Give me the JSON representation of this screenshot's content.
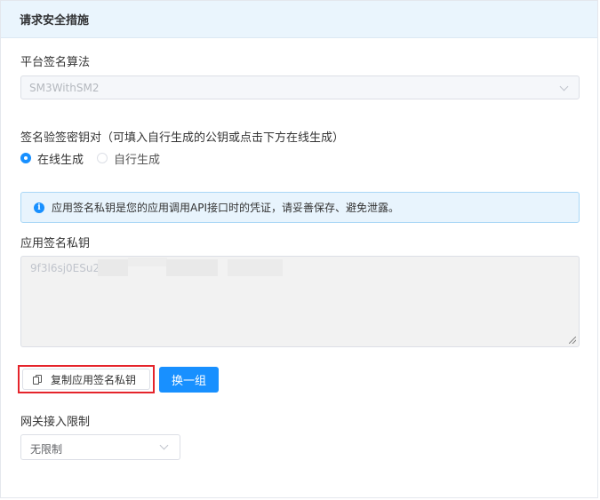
{
  "panel": {
    "title": "请求安全措施"
  },
  "algorithm": {
    "label": "平台签名算法",
    "value": "SM3WithSM2"
  },
  "keypair": {
    "label": "签名验签密钥对（可填入自行生成的公钥或点击下方在线生成）",
    "options": [
      {
        "label": "在线生成",
        "checked": true
      },
      {
        "label": "自行生成",
        "checked": false
      }
    ]
  },
  "alert": {
    "text": "应用签名私钥是您的应用调用API接口时的凭证，请妥善保存、避免泄露。",
    "icon": "info-icon"
  },
  "private_key": {
    "label": "应用签名私钥",
    "value": "9f3l6sj0ESu2…"
  },
  "buttons": {
    "copy": "复制应用签名私钥",
    "regenerate": "换一组"
  },
  "gateway": {
    "label": "网关接入限制",
    "value": "无限制"
  },
  "colors": {
    "accent": "#1890ff",
    "highlight_border": "#e5242b",
    "header_bg": "#eaf5fd"
  }
}
